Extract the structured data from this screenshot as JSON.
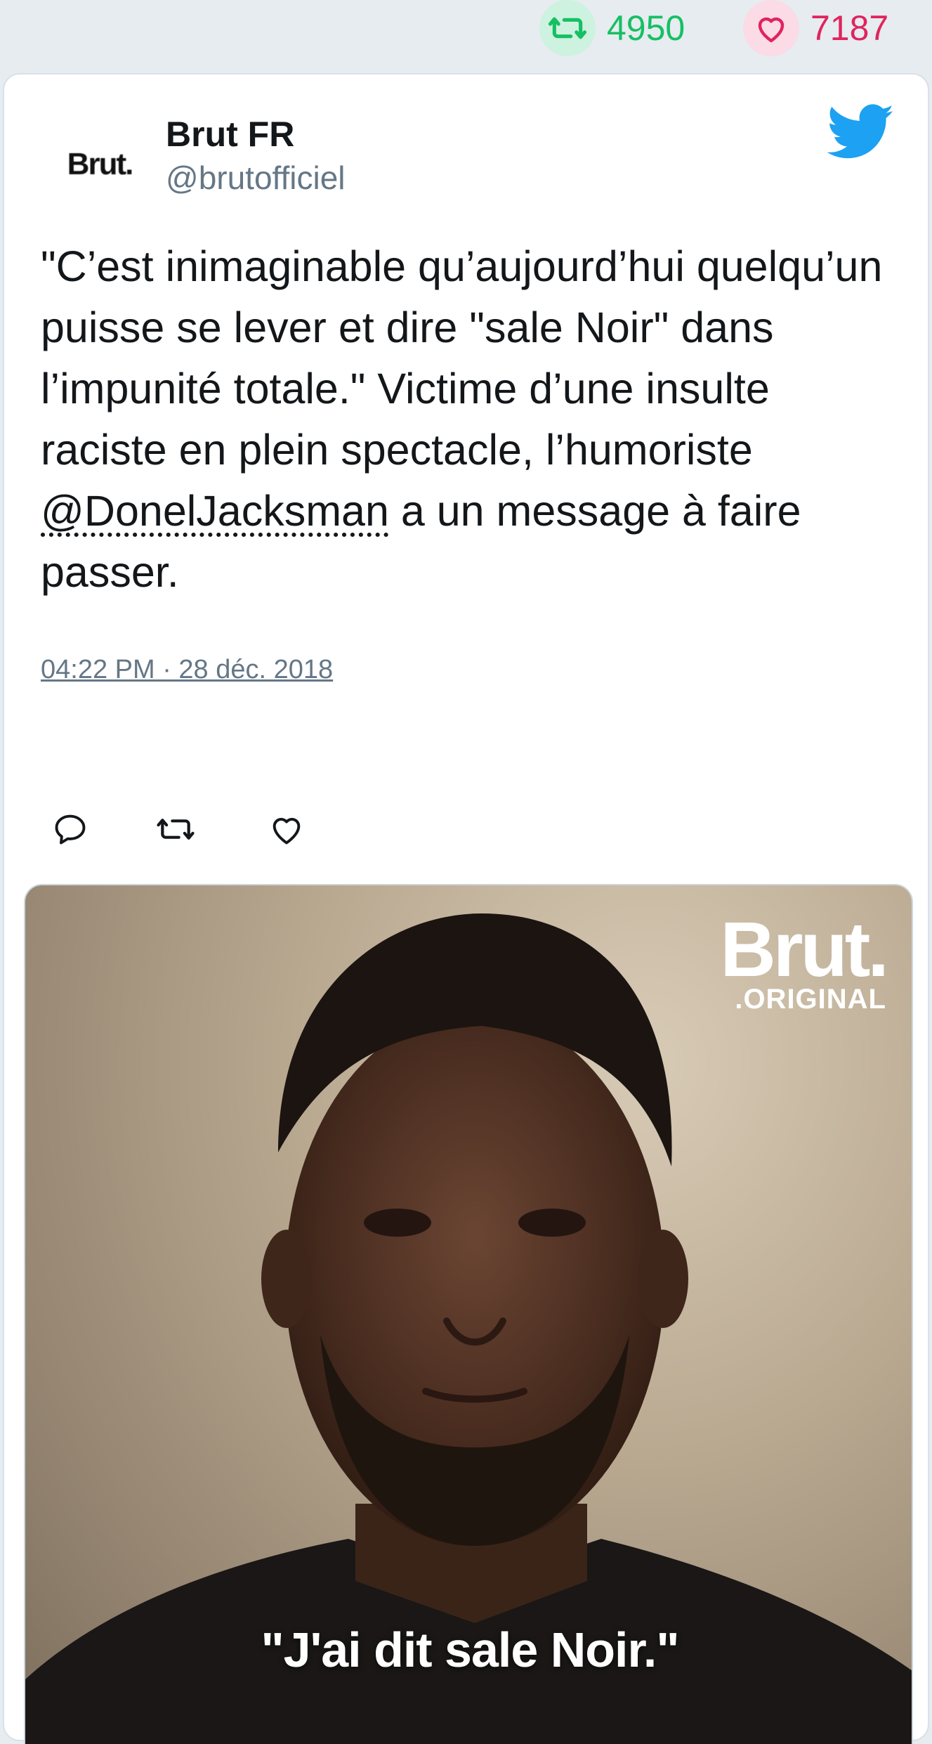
{
  "stats": {
    "retweet_count": "4950",
    "like_count": "7187"
  },
  "icons": {
    "retweet": "retweet-icon",
    "like": "heart-icon",
    "reply": "reply-icon",
    "twitter": "twitter-bird-icon"
  },
  "colors": {
    "retweet_green": "#17bf63",
    "like_red": "#e0245e",
    "twitter_blue": "#1da1f2",
    "secondary_text": "#657786"
  },
  "tweet": {
    "avatar_text": "Brut.",
    "author_name": "Brut FR",
    "author_handle": "@brutofficiel",
    "text_before": "\"C’est inimaginable qu’aujourd’hui quelqu’un puisse se lever et dire \"sale Noir\" dans l’impunité totale.\" Victime d’une insulte raciste en plein spectacle, l’humoriste ",
    "mention": "@DonelJacksman",
    "text_after": " a un message à faire passer.",
    "timestamp": "04:22 PM · 28 déc. 2018"
  },
  "media": {
    "watermark_main": "Brut.",
    "watermark_sub": ".ORIGINAL",
    "caption": "\"J'ai dit sale Noir.\""
  }
}
